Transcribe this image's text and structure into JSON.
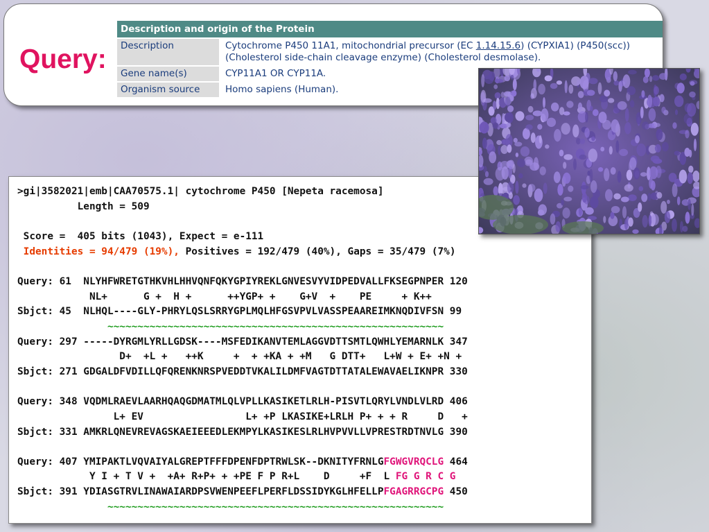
{
  "query_title": "Query:",
  "protein_table": {
    "header": "Description and origin of the Protein",
    "rows": [
      {
        "label": "Description",
        "value_pre": "Cytochrome P450 11A1, mitochondrial precursor (EC ",
        "value_link": "1.14.15.6",
        "value_post": ") (CYPXIA1) (P450(scc))",
        "value_line2": "(Cholesterol side-chain cleavage enzyme) (Cholesterol desmolase)."
      },
      {
        "label": "Gene name(s)",
        "value": "CYP11A1 OR CYP11A."
      },
      {
        "label": "Organism source",
        "value": "Homo sapiens (Human)."
      }
    ]
  },
  "alignment": {
    "header": ">gi|3582021|emb|CAA70575.1| cytochrome P450 [Nepeta racemosa]",
    "length": "          Length = 509",
    "score": " Score =  405 bits (1043), Expect = e-111",
    "identities": " Identities = 94/479 (19%),",
    "positives": " Positives = 192/479 (40%), Gaps = 35/479 (7%)",
    "blocks": [
      {
        "q": "Query: 61  NLYHFWRETGTHKVHLHHVQNFQKYGPIYREKLGNVESVYVIDPEDVALLFKSEGPNPER 120",
        "m": "            NL+      G +  H +      ++YGP+ +    G+V  +    PE     + K++",
        "s": "Sbjct: 45  NLHQL----GLY-PHRYLQSLSRRYGPLMQLHFGSVPVLVASSPEAAREIMKNQDIVFSN 99",
        "tilde": "               ~~~~~~~~~~~~~~~~~~~~~~~~~~~~~~~~~~~~~~~~~~~~~~~~~~~~~~~~"
      },
      {
        "q": "Query: 297 -----DYRGMLYRLLGDSK----MSFEDIKANVTEMLAGGVDTTSMTLQWHLYEMARNLK 347",
        "m": "                 D+  +L +   ++K     +  + +KA + +M   G DTT+   L+W + E+ +N +",
        "s": "Sbjct: 271 GDGALDFVDILLQFQRENKNRSPVEDDTVKALILDMFVAGTDTTATALEWAVAELIKNPR 330"
      },
      {
        "q": "Query: 348 VQDMLRAEVLAARHQAQGDMATMLQLVPLLKASIKETLRLH-PISVTLQRYLVNDLVLRD 406",
        "m": "                L+ EV                 L+ +P LKASIKE+LRLH P+ + + R     D   +",
        "s": "Sbjct: 331 AMKRLQNEVREVAGSKAEIEEEDLEKMPYLKASIKESLRLHVPVVLLVPRESTRDTNVLG 390"
      },
      {
        "q_pre": "Query: 407 YMIPAKTLVQVAIYALGREPTFFFDPENFDPTRWLSK--DKNITYFRNLG",
        "q_hl": "FGWGVRQCLG",
        "q_post": " 464",
        "m_pre": "            Y I + T V +  +A+ R+P+ + +PE F P R+L    D     +F  L ",
        "m_hl": "FG G R C G",
        "s_pre": "Sbjct: 391 YDIASGTRVLINAWAIARDPSVWENPEEFLPERFLDSSIDYKGLHFELLP",
        "s_hl": "FGAGRRGCPG",
        "s_post": " 450",
        "tilde": "               ~~~~~~~~~~~~~~~~~~~~~~~~~~~~~~~~~~~~~~~~~~~~~~~~~~~~~~~~"
      }
    ]
  },
  "colors": {
    "title": "#e0135f",
    "identities": "#e63c00",
    "motif": "#e0157a",
    "tilde": "#1a9a1a",
    "table_header": "#4f8a86"
  },
  "photo": {
    "subject": "purple flowering plant (Nepeta)"
  }
}
